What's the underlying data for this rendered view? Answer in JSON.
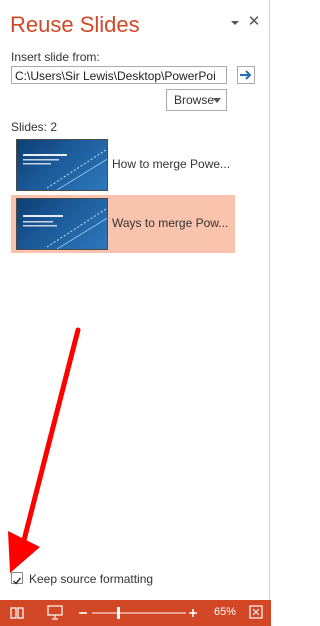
{
  "pane": {
    "title": "Reuse Slides",
    "insert_label": "Insert slide from:",
    "path_value": "C:\\Users\\Sir Lewis\\Desktop\\PowerPoi",
    "browse_label": "Browse",
    "slides_count_label": "Slides: 2",
    "slides": [
      {
        "label": "How to merge Powe...",
        "selected": false
      },
      {
        "label": "Ways to merge Pow...",
        "selected": true
      }
    ],
    "keep_formatting_label": "Keep source formatting",
    "keep_formatting_checked": true
  },
  "status_bar": {
    "zoom_label": "65%",
    "zoom_level_percent": 65
  },
  "colors": {
    "accent": "#d24726",
    "selection": "#f9c3ad",
    "annotation_arrow": "#ff0000",
    "go_arrow": "#2b6cb0"
  },
  "icons": {
    "pane_menu": "chevron-down-icon",
    "pane_close": "close-icon",
    "go": "arrow-right-icon",
    "notes": "notes-icon",
    "slideshow": "slideshow-icon",
    "zoom_out": "minus-icon",
    "zoom_in": "plus-icon",
    "fit": "fit-to-window-icon"
  }
}
